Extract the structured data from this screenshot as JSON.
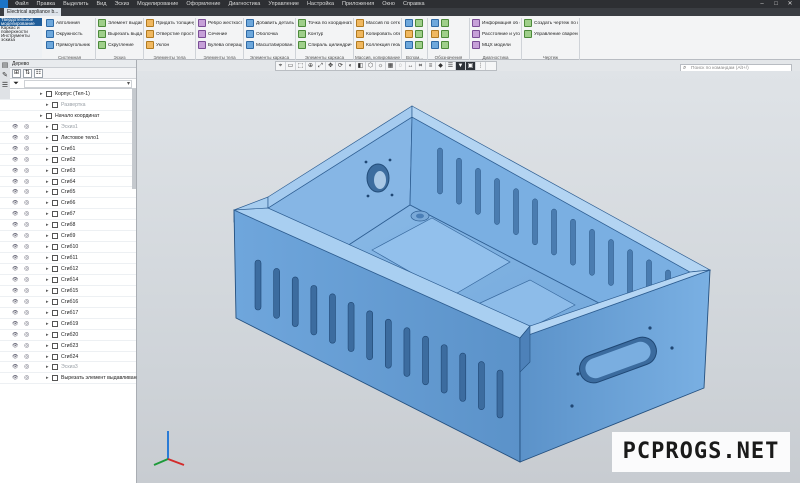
{
  "titlebar": {
    "menus": [
      "Файл",
      "Правка",
      "Выделить",
      "Вид",
      "Эскиз",
      "Моделирование",
      "Оформление",
      "Диагностика",
      "Управление",
      "Настройка",
      "Приложения",
      "Окно",
      "Справка"
    ],
    "min": "–",
    "max": "□",
    "close": "✕"
  },
  "doctab": {
    "title": "Electrical appliance b..."
  },
  "ribbon": {
    "left": [
      "Твердотельное моделирование",
      "Каркас и поверхности",
      "Инструменты эскиза"
    ],
    "groups": [
      {
        "cap": "Системная",
        "items": [
          "Автолиния",
          "Окружность",
          "Прямоугольник"
        ]
      },
      {
        "cap": "Эскиз",
        "items": [
          "Элемент выдавливания",
          "Вырезать выдавливанием",
          "Скругление"
        ]
      },
      {
        "cap": "Элементы тела",
        "items": [
          "Придать толщину",
          "Отверстие простое",
          "Уклон"
        ]
      },
      {
        "cap": "Элементы тела",
        "items": [
          "Ребро жесткости",
          "Сечение",
          "Булева операция"
        ]
      },
      {
        "cap": "Элементы каркаса",
        "items": [
          "Добавить деталь-заготов...",
          "Оболочка",
          "Масштабирован..."
        ]
      },
      {
        "cap": "Элементы каркаса",
        "items": [
          "Точка по координатам",
          "Контур",
          "Спираль цилиндрическ..."
        ]
      },
      {
        "cap": "Массив, копирование",
        "items": [
          "Массив по сетке",
          "Копировать объекты",
          "Коллекция геометрии"
        ]
      },
      {
        "cap": "Вспом...",
        "items": []
      },
      {
        "cap": "Обозначения",
        "items": []
      },
      {
        "cap": "Диагностика",
        "items": [
          "Информация об объекте",
          "Расстояние и угол",
          "МЦХ модели"
        ]
      },
      {
        "cap": "Чертеж",
        "items": [
          "Создать чертеж по модели",
          "Управление сваренными ч..."
        ]
      }
    ]
  },
  "search": {
    "placeholder": "Поиск по командам (Alt+/)"
  },
  "panel": {
    "title": "Дерево"
  },
  "tree": [
    {
      "label": "Корпус (Тел-1)",
      "indent": 46,
      "eye": false,
      "dim": false
    },
    {
      "label": "Развертка",
      "indent": 52,
      "eye": false,
      "dim": true
    },
    {
      "label": "Начало координат",
      "indent": 46,
      "eye": false,
      "dim": false
    },
    {
      "label": "Эскиз1",
      "indent": 52,
      "eye": true,
      "dim": true
    },
    {
      "label": "Листовое тело1",
      "indent": 52,
      "eye": true,
      "dim": false
    },
    {
      "label": "Сгиб1",
      "indent": 52,
      "eye": true,
      "dim": false
    },
    {
      "label": "Сгиб2",
      "indent": 52,
      "eye": true,
      "dim": false
    },
    {
      "label": "Сгиб3",
      "indent": 52,
      "eye": true,
      "dim": false
    },
    {
      "label": "Сгиб4",
      "indent": 52,
      "eye": true,
      "dim": false
    },
    {
      "label": "Сгиб5",
      "indent": 52,
      "eye": true,
      "dim": false
    },
    {
      "label": "Сгиб6",
      "indent": 52,
      "eye": true,
      "dim": false
    },
    {
      "label": "Сгиб7",
      "indent": 52,
      "eye": true,
      "dim": false
    },
    {
      "label": "Сгиб8",
      "indent": 52,
      "eye": true,
      "dim": false
    },
    {
      "label": "Сгиб9",
      "indent": 52,
      "eye": true,
      "dim": false
    },
    {
      "label": "Сгиб10",
      "indent": 52,
      "eye": true,
      "dim": false
    },
    {
      "label": "Сгиб11",
      "indent": 52,
      "eye": true,
      "dim": false
    },
    {
      "label": "Сгиб12",
      "indent": 52,
      "eye": true,
      "dim": false
    },
    {
      "label": "Сгиб14",
      "indent": 52,
      "eye": true,
      "dim": false
    },
    {
      "label": "Сгиб15",
      "indent": 52,
      "eye": true,
      "dim": false
    },
    {
      "label": "Сгиб16",
      "indent": 52,
      "eye": true,
      "dim": false
    },
    {
      "label": "Сгиб17",
      "indent": 52,
      "eye": true,
      "dim": false
    },
    {
      "label": "Сгиб19",
      "indent": 52,
      "eye": true,
      "dim": false
    },
    {
      "label": "Сгиб20",
      "indent": 52,
      "eye": true,
      "dim": false
    },
    {
      "label": "Сгиб23",
      "indent": 52,
      "eye": true,
      "dim": false
    },
    {
      "label": "Сгиб24",
      "indent": 52,
      "eye": true,
      "dim": false
    },
    {
      "label": "Эскиз3",
      "indent": 52,
      "eye": true,
      "dim": true
    },
    {
      "label": "Вырезать элемент выдавливания2",
      "indent": 52,
      "eye": true,
      "dim": false
    }
  ],
  "watermark": "PCPROGS.NET",
  "colors": {
    "model": "#6ba2d8",
    "model_dark": "#3f74ad",
    "model_light": "#9cc6ee",
    "selection": "#1f5d99"
  }
}
